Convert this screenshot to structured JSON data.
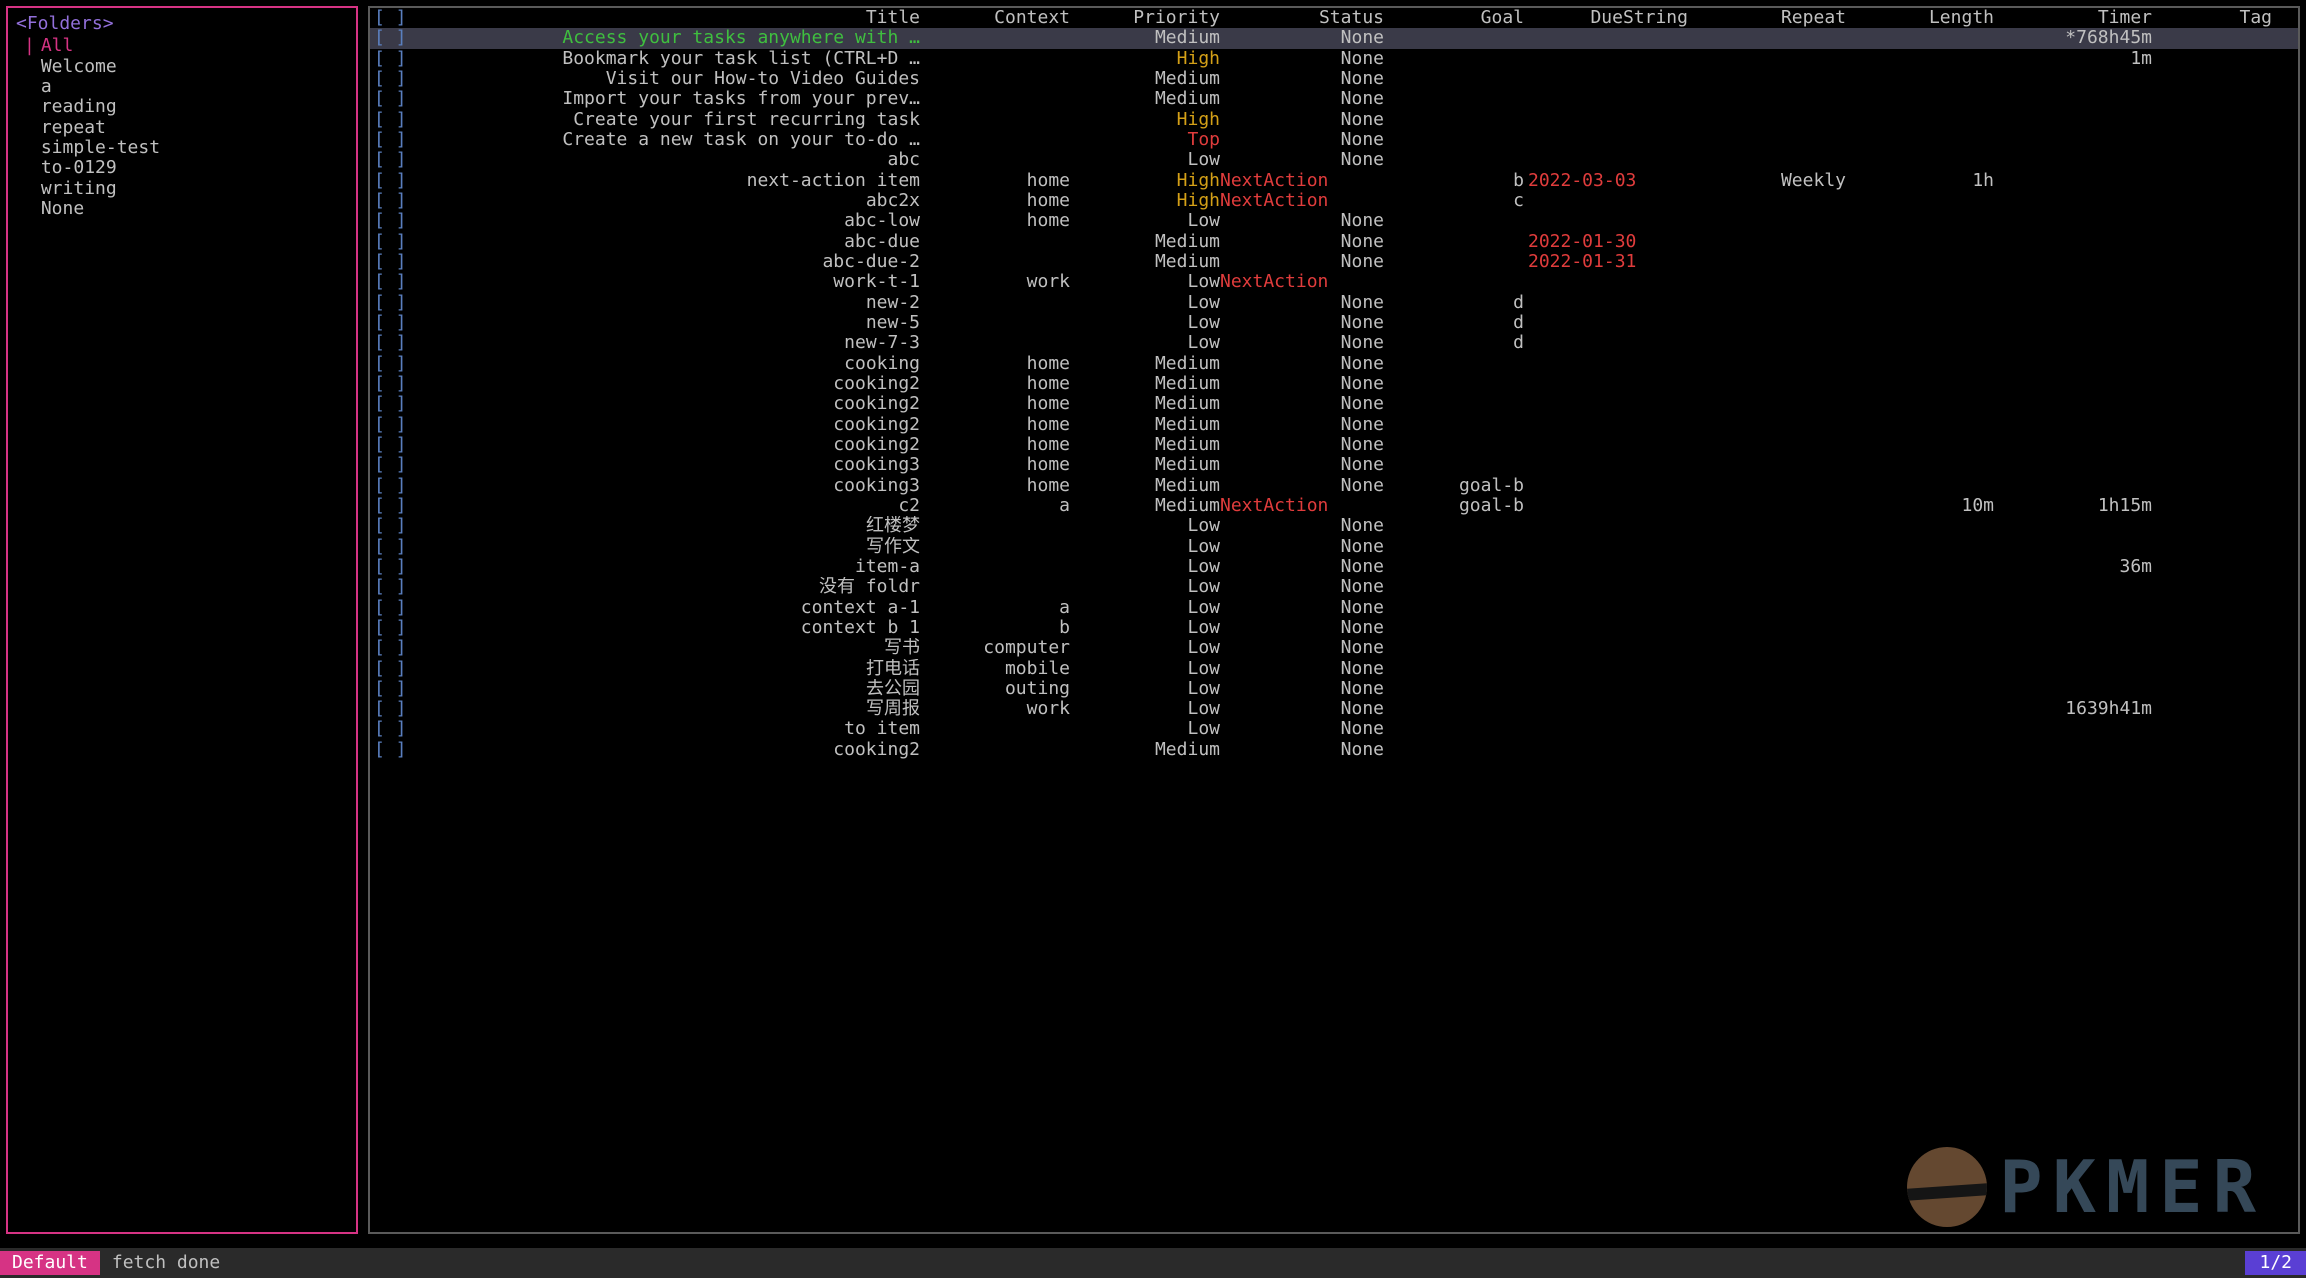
{
  "sidebar": {
    "title": "<Folders>",
    "items": [
      {
        "label": "All",
        "selected": true
      },
      {
        "label": "Welcome",
        "selected": false
      },
      {
        "label": "a",
        "selected": false
      },
      {
        "label": "reading",
        "selected": false
      },
      {
        "label": "repeat",
        "selected": false
      },
      {
        "label": "simple-test",
        "selected": false
      },
      {
        "label": "to-0129",
        "selected": false
      },
      {
        "label": "writing",
        "selected": false
      },
      {
        "label": "None",
        "selected": false
      }
    ]
  },
  "columns": {
    "checkbox": "[ ]",
    "title": "Title",
    "context": "Context",
    "priority": "Priority",
    "status": "Status",
    "goal": "Goal",
    "due": "DueString",
    "repeat": "Repeat",
    "length": "Length",
    "timer": "Timer",
    "tag": "Tag"
  },
  "tasks": [
    {
      "cb": "[ ]",
      "title": "Access your tasks anywhere with …",
      "tclass": "green",
      "context": "",
      "priority": "Medium",
      "status": "None",
      "goal": "",
      "due": "",
      "repeat": "",
      "length": "",
      "timer": "*768h45m",
      "selected": true
    },
    {
      "cb": "[ ]",
      "title": "Bookmark your task list (CTRL+D …",
      "context": "",
      "priority": "High",
      "status": "None",
      "goal": "",
      "due": "",
      "repeat": "",
      "length": "",
      "timer": "1m"
    },
    {
      "cb": "[ ]",
      "title": "Visit our How-to Video Guides",
      "context": "",
      "priority": "Medium",
      "status": "None",
      "goal": "",
      "due": "",
      "repeat": "",
      "length": "",
      "timer": ""
    },
    {
      "cb": "[ ]",
      "title": "Import your tasks from your prev…",
      "context": "",
      "priority": "Medium",
      "status": "None",
      "goal": "",
      "due": "",
      "repeat": "",
      "length": "",
      "timer": ""
    },
    {
      "cb": "[ ]",
      "title": "Create your first recurring task",
      "context": "",
      "priority": "High",
      "status": "None",
      "goal": "",
      "due": "",
      "repeat": "",
      "length": "",
      "timer": ""
    },
    {
      "cb": "[ ]",
      "title": "Create a new task on your to-do …",
      "context": "",
      "priority": "Top",
      "status": "None",
      "goal": "",
      "due": "",
      "repeat": "",
      "length": "",
      "timer": ""
    },
    {
      "cb": "[ ]",
      "title": "abc",
      "context": "",
      "priority": "Low",
      "status": "None",
      "goal": "",
      "due": "",
      "repeat": "",
      "length": "",
      "timer": ""
    },
    {
      "cb": "[ ]",
      "title": "next-action item",
      "context": "home",
      "priority": "High",
      "status": "NextAction",
      "goal": "b",
      "due": "2022-03-03",
      "repeat": "Weekly",
      "length": "1h",
      "timer": ""
    },
    {
      "cb": "[ ]",
      "title": "abc2x",
      "context": "home",
      "priority": "High",
      "status": "NextAction",
      "goal": "c",
      "due": "",
      "repeat": "",
      "length": "",
      "timer": ""
    },
    {
      "cb": "[ ]",
      "title": "abc-low",
      "context": "home",
      "priority": "Low",
      "status": "None",
      "goal": "",
      "due": "",
      "repeat": "",
      "length": "",
      "timer": ""
    },
    {
      "cb": "[ ]",
      "title": "abc-due",
      "context": "",
      "priority": "Medium",
      "status": "None",
      "goal": "",
      "due": "2022-01-30",
      "repeat": "",
      "length": "",
      "timer": ""
    },
    {
      "cb": "[ ]",
      "title": "abc-due-2",
      "context": "",
      "priority": "Medium",
      "status": "None",
      "goal": "",
      "due": "2022-01-31",
      "repeat": "",
      "length": "",
      "timer": ""
    },
    {
      "cb": "[ ]",
      "title": "work-t-1",
      "context": "work",
      "priority": "Low",
      "status": "NextAction",
      "goal": "",
      "due": "",
      "repeat": "",
      "length": "",
      "timer": ""
    },
    {
      "cb": "[ ]",
      "title": "new-2",
      "context": "",
      "priority": "Low",
      "status": "None",
      "goal": "d",
      "due": "",
      "repeat": "",
      "length": "",
      "timer": ""
    },
    {
      "cb": "[ ]",
      "title": "new-5",
      "context": "",
      "priority": "Low",
      "status": "None",
      "goal": "d",
      "due": "",
      "repeat": "",
      "length": "",
      "timer": ""
    },
    {
      "cb": "[ ]",
      "title": "new-7-3",
      "context": "",
      "priority": "Low",
      "status": "None",
      "goal": "d",
      "due": "",
      "repeat": "",
      "length": "",
      "timer": ""
    },
    {
      "cb": "[ ]",
      "title": "cooking",
      "context": "home",
      "priority": "Medium",
      "status": "None",
      "goal": "",
      "due": "",
      "repeat": "",
      "length": "",
      "timer": ""
    },
    {
      "cb": "[ ]",
      "title": "cooking2",
      "context": "home",
      "priority": "Medium",
      "status": "None",
      "goal": "",
      "due": "",
      "repeat": "",
      "length": "",
      "timer": ""
    },
    {
      "cb": "[ ]",
      "title": "cooking2",
      "context": "home",
      "priority": "Medium",
      "status": "None",
      "goal": "",
      "due": "",
      "repeat": "",
      "length": "",
      "timer": ""
    },
    {
      "cb": "[ ]",
      "title": "cooking2",
      "context": "home",
      "priority": "Medium",
      "status": "None",
      "goal": "",
      "due": "",
      "repeat": "",
      "length": "",
      "timer": ""
    },
    {
      "cb": "[ ]",
      "title": "cooking2",
      "context": "home",
      "priority": "Medium",
      "status": "None",
      "goal": "",
      "due": "",
      "repeat": "",
      "length": "",
      "timer": ""
    },
    {
      "cb": "[ ]",
      "title": "cooking3",
      "context": "home",
      "priority": "Medium",
      "status": "None",
      "goal": "",
      "due": "",
      "repeat": "",
      "length": "",
      "timer": ""
    },
    {
      "cb": "[ ]",
      "title": "cooking3",
      "context": "home",
      "priority": "Medium",
      "status": "None",
      "goal": "goal-b",
      "due": "",
      "repeat": "",
      "length": "",
      "timer": ""
    },
    {
      "cb": "[ ]",
      "title": "c2",
      "context": "a",
      "priority": "Medium",
      "status": "NextAction",
      "goal": "goal-b",
      "due": "",
      "repeat": "",
      "length": "10m",
      "timer": "1h15m"
    },
    {
      "cb": "[ ]",
      "title": "红楼梦",
      "context": "",
      "priority": "Low",
      "status": "None",
      "goal": "",
      "due": "",
      "repeat": "",
      "length": "",
      "timer": ""
    },
    {
      "cb": "[ ]",
      "title": "写作文",
      "context": "",
      "priority": "Low",
      "status": "None",
      "goal": "",
      "due": "",
      "repeat": "",
      "length": "",
      "timer": ""
    },
    {
      "cb": "[ ]",
      "title": "item-a",
      "context": "",
      "priority": "Low",
      "status": "None",
      "goal": "",
      "due": "",
      "repeat": "",
      "length": "",
      "timer": "36m"
    },
    {
      "cb": "[ ]",
      "title": "没有 foldr",
      "context": "",
      "priority": "Low",
      "status": "None",
      "goal": "",
      "due": "",
      "repeat": "",
      "length": "",
      "timer": ""
    },
    {
      "cb": "[ ]",
      "title": "context a-1",
      "context": "a",
      "priority": "Low",
      "status": "None",
      "goal": "",
      "due": "",
      "repeat": "",
      "length": "",
      "timer": ""
    },
    {
      "cb": "[ ]",
      "title": "context b 1",
      "context": "b",
      "priority": "Low",
      "status": "None",
      "goal": "",
      "due": "",
      "repeat": "",
      "length": "",
      "timer": ""
    },
    {
      "cb": "[ ]",
      "title": "写书",
      "context": "computer",
      "priority": "Low",
      "status": "None",
      "goal": "",
      "due": "",
      "repeat": "",
      "length": "",
      "timer": ""
    },
    {
      "cb": "[ ]",
      "title": "打电话",
      "context": "mobile",
      "priority": "Low",
      "status": "None",
      "goal": "",
      "due": "",
      "repeat": "",
      "length": "",
      "timer": ""
    },
    {
      "cb": "[ ]",
      "title": "去公园",
      "context": "outing",
      "priority": "Low",
      "status": "None",
      "goal": "",
      "due": "",
      "repeat": "",
      "length": "",
      "timer": ""
    },
    {
      "cb": "[ ]",
      "title": "写周报",
      "context": "work",
      "priority": "Low",
      "status": "None",
      "goal": "",
      "due": "",
      "repeat": "",
      "length": "",
      "timer": "1639h41m"
    },
    {
      "cb": "[ ]",
      "title": "to item",
      "context": "",
      "priority": "Low",
      "status": "None",
      "goal": "",
      "due": "",
      "repeat": "",
      "length": "",
      "timer": ""
    },
    {
      "cb": "[ ]",
      "title": "cooking2",
      "context": "",
      "priority": "Medium",
      "status": "None",
      "goal": "",
      "due": "",
      "repeat": "",
      "length": "",
      "timer": ""
    }
  ],
  "statusbar": {
    "mode": "Default",
    "message": "fetch done",
    "page": "1/2"
  },
  "watermark": "PKMER"
}
